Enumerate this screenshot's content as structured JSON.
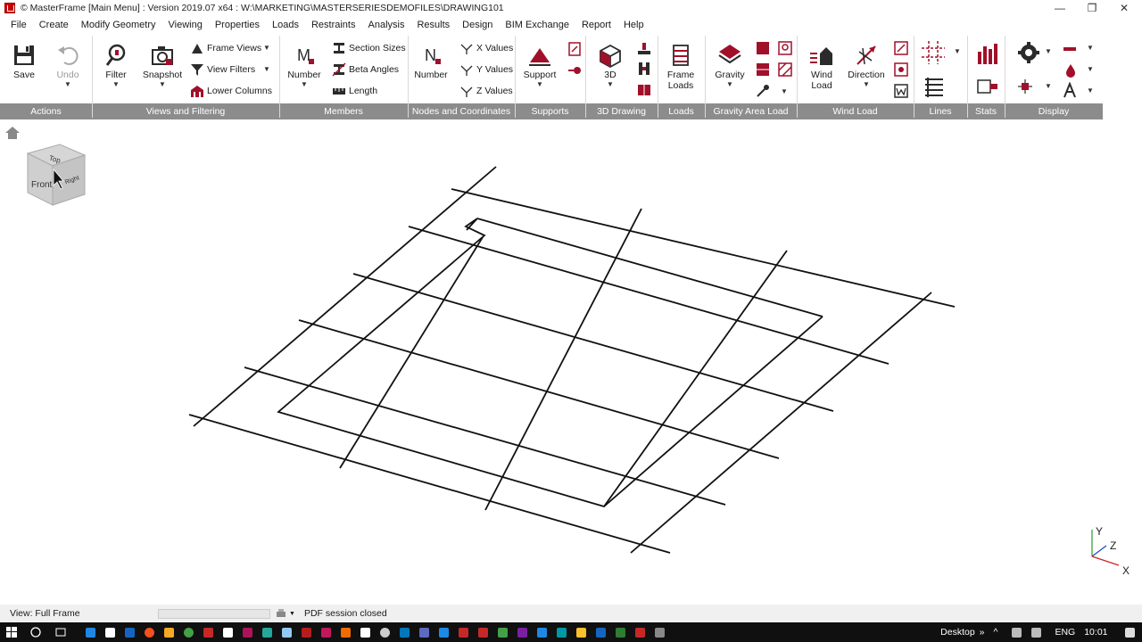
{
  "window": {
    "title": "© MasterFrame [Main Menu] : Version 2019.07 x64 : W:\\MARKETING\\MASTERSERIESDEMOFILES\\DRAWING101",
    "minimize": "—",
    "restore": "❐",
    "close": "✕"
  },
  "menu": [
    "File",
    "Create",
    "Modify Geometry",
    "Viewing",
    "Properties",
    "Loads",
    "Restraints",
    "Analysis",
    "Results",
    "Design",
    "BIM Exchange",
    "Report",
    "Help"
  ],
  "ribbon": {
    "save": "Save",
    "undo": "Undo",
    "filter": "Filter",
    "snapshot": "Snapshot",
    "frame_views": "Frame Views",
    "view_filters": "View Filters",
    "lower_columns": "Lower Columns",
    "members_number": "Number",
    "section_sizes": "Section Sizes",
    "beta_angles": "Beta Angles",
    "length": "Length",
    "nodes_number": "Number",
    "x_values": "X Values",
    "y_values": "Y Values",
    "z_values": "Z Values",
    "support": "Support",
    "three_d": "3D",
    "frame_loads_1": "Frame",
    "frame_loads_2": "Loads",
    "gravity": "Gravity",
    "wind_load_1": "Wind",
    "wind_load_2": "Load",
    "direction": "Direction",
    "members_glyph": "M",
    "nodes_glyph": "N"
  },
  "groups": {
    "actions": "Actions",
    "views": "Views and Filtering",
    "members": "Members",
    "nodes": "Nodes and Coordinates",
    "supports": "Supports",
    "drawing3d": "3D Drawing",
    "loads": "Loads",
    "gravity_area": "Gravity Area Load",
    "wind": "Wind Load",
    "lines": "Lines",
    "stats": "Stats",
    "display": "Display"
  },
  "viewcube": {
    "top": "Top",
    "front": "Front",
    "right": "Right"
  },
  "axes": {
    "y": "Y",
    "z": "Z",
    "x": "X"
  },
  "status": {
    "view": "View: Full Frame",
    "pdf": "PDF session closed"
  },
  "taskbar": {
    "desktop": "Desktop",
    "lang": "ENG",
    "time": "10:01"
  },
  "colors": {
    "ribbon_footer": "#8c8c8c",
    "brand_red": "#a0102a",
    "icon_dark": "#2b2b2b"
  }
}
